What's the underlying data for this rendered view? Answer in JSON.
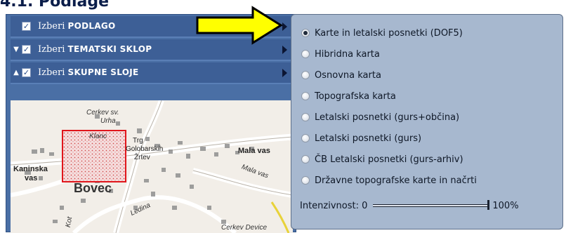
{
  "heading": "4.1. Podlage",
  "layer_rows": [
    {
      "prefix": "Izberi ",
      "bold": "PODLAGO",
      "checked": true,
      "arrow": ""
    },
    {
      "prefix": "Izberi ",
      "bold": "TEMATSKI SKLOP",
      "checked": true,
      "arrow": "▼"
    },
    {
      "prefix": "Izberi ",
      "bold": "SKUPNE SLOJE",
      "checked": true,
      "arrow": "▲"
    }
  ],
  "map": {
    "labels": [
      "Cerkev sv.",
      "Urha",
      "Klanc",
      "Trg",
      "Golobarskih",
      "Žrtev",
      "Mala vas",
      "Kaninska",
      "vas",
      "Bovec",
      "Mala vas",
      "Ledina",
      "Kot",
      "Cerkev Device"
    ]
  },
  "basemap_options": [
    {
      "label": "Karte in letalski posnetki (DOF5)",
      "selected": true
    },
    {
      "label": "Hibridna karta",
      "selected": false
    },
    {
      "label": "Osnovna karta",
      "selected": false
    },
    {
      "label": "Topografska karta",
      "selected": false
    },
    {
      "label": "Letalski posnetki (gurs+občina)",
      "selected": false
    },
    {
      "label": "Letalski posnetki (gurs)",
      "selected": false
    },
    {
      "label": "ČB Letalski posnetki (gurs-arhiv)",
      "selected": false
    },
    {
      "label": "Državne topografske karte in načrti",
      "selected": false
    }
  ],
  "intensity": {
    "label": "Intenzivnost: 0",
    "max_label": "100%",
    "value": 1.0
  },
  "colors": {
    "panel": "#4a6fa5",
    "row": "#3d5f96",
    "popup": "#a7b8cf",
    "pointer_arrow": "#ffff00",
    "selection_box": "#e0151b"
  },
  "icons": {
    "pointer": "yellow-arrow-icon",
    "expand": "triangle-right-icon"
  }
}
